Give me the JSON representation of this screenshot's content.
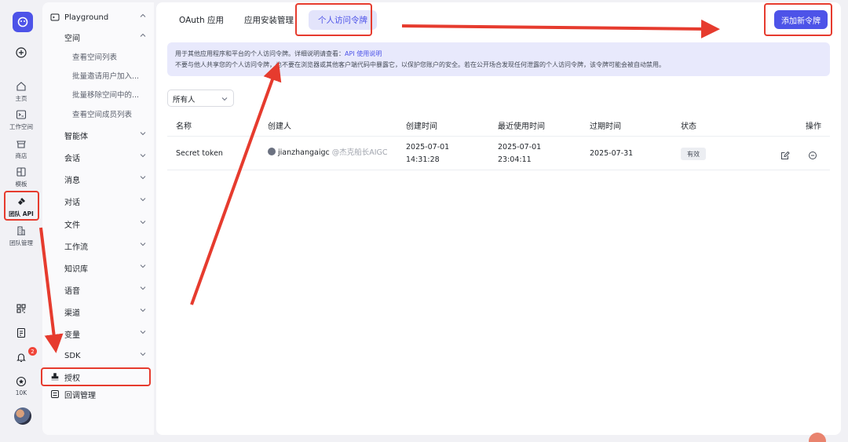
{
  "rail": {
    "items": [
      {
        "label": "",
        "icon": "plus-circle-icon"
      },
      {
        "label": "主页",
        "icon": "home-icon"
      },
      {
        "label": "工作空间",
        "icon": "terminal-icon"
      },
      {
        "label": "商店",
        "icon": "store-icon"
      },
      {
        "label": "模板",
        "icon": "template-icon"
      },
      {
        "label": "团队 API",
        "icon": "api-icon"
      },
      {
        "label": "团队管理",
        "icon": "building-icon"
      },
      {
        "label": "",
        "icon": "grid-icon"
      },
      {
        "label": "",
        "icon": "doc-icon"
      },
      {
        "label": "",
        "icon": "bell-icon"
      },
      {
        "label": "10K",
        "icon": "star-icon"
      }
    ],
    "notification_count": "2"
  },
  "nav": {
    "playground": "Playground",
    "space": "空间",
    "space_items": [
      "查看空间列表",
      "批量邀请用户加入...",
      "批量移除空间中的...",
      "查看空间成员列表"
    ],
    "groups": [
      "智能体",
      "会话",
      "消息",
      "对话",
      "文件",
      "工作流",
      "知识库",
      "语音",
      "渠道",
      "变量",
      "SDK"
    ],
    "auth": "授权",
    "callback": "回调管理"
  },
  "tabs": [
    "OAuth 应用",
    "应用安装管理",
    "个人访问令牌"
  ],
  "add_button": "添加新令牌",
  "notice": {
    "line1": "用于其他应用程序和平台的个人访问令牌。详细说明请查看：",
    "link": "API 使用说明",
    "line2": "不要与他人共享您的个人访问令牌，也不要在浏览器或其他客户端代码中暴露它，以保护您账户的安全。若在公开场合发现任何泄露的个人访问令牌，该令牌可能会被自动禁用。"
  },
  "filter": {
    "value": "所有人"
  },
  "table": {
    "headers": [
      "名称",
      "创建人",
      "创建时间",
      "最近使用时间",
      "过期时间",
      "状态",
      "操作"
    ],
    "rows": [
      {
        "name": "Secret token",
        "creator": "jianzhangaigc",
        "creator_note": "@杰克船长AIGC",
        "created_date": "2025-07-01",
        "created_time": "14:31:28",
        "last_used_date": "2025-07-01",
        "last_used_time": "23:04:11",
        "expires": "2025-07-31",
        "status": "有效"
      }
    ]
  },
  "colors": {
    "accent": "#4d53e8",
    "highlight": "#e63b2e"
  }
}
